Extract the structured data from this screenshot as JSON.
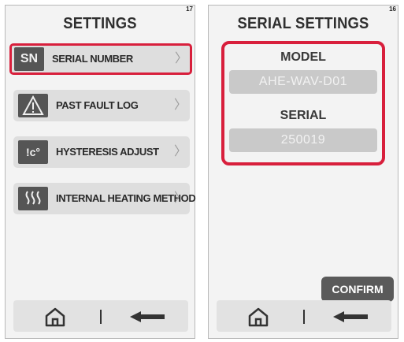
{
  "left_screen": {
    "page_number": "17",
    "title": "SETTINGS",
    "items": [
      {
        "icon": "SN",
        "label": "SERIAL NUMBER",
        "icon_name": "serial-number-icon",
        "highlighted": true
      },
      {
        "icon": "⚠",
        "label": "PAST FAULT LOG",
        "icon_name": "warning-icon",
        "highlighted": false
      },
      {
        "icon": "!c°",
        "label": "HYSTERESIS ADJUST",
        "icon_name": "hysteresis-icon",
        "highlighted": false
      },
      {
        "icon": "≋",
        "label": "INTERNAL HEATING METHOD",
        "icon_name": "heating-icon",
        "highlighted": false
      }
    ],
    "chevron": "〉"
  },
  "right_screen": {
    "page_number": "16",
    "title": "SERIAL SETTINGS",
    "model_label": "MODEL",
    "model_value": "AHE-WAV-D01",
    "serial_label": "SERIAL",
    "serial_value": "250019",
    "confirm_label": "CONFIRM"
  },
  "colors": {
    "highlight": "#d81f3c",
    "icon_bg": "#555555",
    "button_bg": "#5a5a5a"
  }
}
